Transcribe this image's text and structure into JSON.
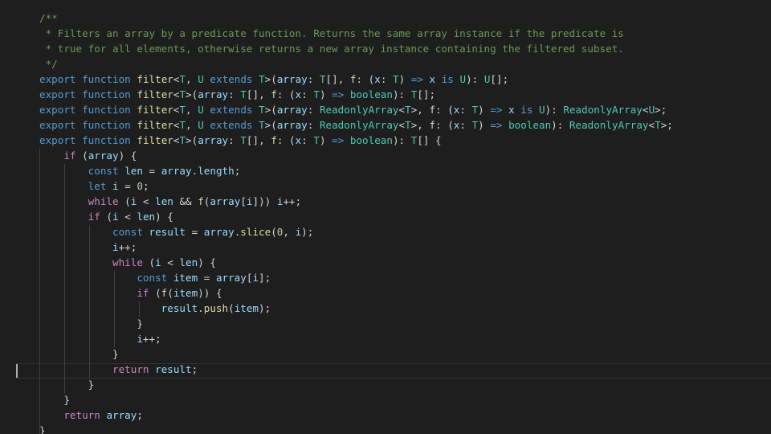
{
  "editor": {
    "theme_colors": {
      "background": "#1e1e1e",
      "keyword": "#569cd6",
      "control": "#c586c0",
      "function": "#dcdcaa",
      "type": "#4ec9b0",
      "variable": "#9cdcfe",
      "comment": "#6a9955",
      "number": "#b5cea8",
      "text": "#d4d4d4"
    },
    "lines": [
      [
        {
          "t": "/**",
          "c": "cm"
        }
      ],
      [
        {
          "t": " * Filters an array by a predicate function. Returns the same array instance if the predicate is",
          "c": "cm"
        }
      ],
      [
        {
          "t": " * true for all elements, otherwise returns a new array instance containing the filtered subset.",
          "c": "cm"
        }
      ],
      [
        {
          "t": " */",
          "c": "cm"
        }
      ],
      [
        {
          "t": "export",
          "c": "kw"
        },
        {
          "t": " "
        },
        {
          "t": "function",
          "c": "kw"
        },
        {
          "t": " "
        },
        {
          "t": "filter",
          "c": "fn"
        },
        {
          "t": "<"
        },
        {
          "t": "T",
          "c": "ty"
        },
        {
          "t": ", "
        },
        {
          "t": "U",
          "c": "ty"
        },
        {
          "t": " "
        },
        {
          "t": "extends",
          "c": "kw"
        },
        {
          "t": " "
        },
        {
          "t": "T",
          "c": "ty"
        },
        {
          "t": ">("
        },
        {
          "t": "array",
          "c": "var"
        },
        {
          "t": ": "
        },
        {
          "t": "T",
          "c": "ty"
        },
        {
          "t": "[], "
        },
        {
          "t": "f",
          "c": "fn"
        },
        {
          "t": ": ("
        },
        {
          "t": "x",
          "c": "var"
        },
        {
          "t": ": "
        },
        {
          "t": "T",
          "c": "ty"
        },
        {
          "t": ") "
        },
        {
          "t": "=>",
          "c": "kw"
        },
        {
          "t": " "
        },
        {
          "t": "x",
          "c": "var"
        },
        {
          "t": " "
        },
        {
          "t": "is",
          "c": "kw"
        },
        {
          "t": " "
        },
        {
          "t": "U",
          "c": "ty"
        },
        {
          "t": "): "
        },
        {
          "t": "U",
          "c": "ty"
        },
        {
          "t": "[];"
        }
      ],
      [
        {
          "t": "export",
          "c": "kw"
        },
        {
          "t": " "
        },
        {
          "t": "function",
          "c": "kw"
        },
        {
          "t": " "
        },
        {
          "t": "filter",
          "c": "fn"
        },
        {
          "t": "<"
        },
        {
          "t": "T",
          "c": "ty"
        },
        {
          "t": ">("
        },
        {
          "t": "array",
          "c": "var"
        },
        {
          "t": ": "
        },
        {
          "t": "T",
          "c": "ty"
        },
        {
          "t": "[], "
        },
        {
          "t": "f",
          "c": "fn"
        },
        {
          "t": ": ("
        },
        {
          "t": "x",
          "c": "var"
        },
        {
          "t": ": "
        },
        {
          "t": "T",
          "c": "ty"
        },
        {
          "t": ") "
        },
        {
          "t": "=>",
          "c": "kw"
        },
        {
          "t": " "
        },
        {
          "t": "boolean",
          "c": "ty"
        },
        {
          "t": "): "
        },
        {
          "t": "T",
          "c": "ty"
        },
        {
          "t": "[];"
        }
      ],
      [
        {
          "t": "export",
          "c": "kw"
        },
        {
          "t": " "
        },
        {
          "t": "function",
          "c": "kw"
        },
        {
          "t": " "
        },
        {
          "t": "filter",
          "c": "fn"
        },
        {
          "t": "<"
        },
        {
          "t": "T",
          "c": "ty"
        },
        {
          "t": ", "
        },
        {
          "t": "U",
          "c": "ty"
        },
        {
          "t": " "
        },
        {
          "t": "extends",
          "c": "kw"
        },
        {
          "t": " "
        },
        {
          "t": "T",
          "c": "ty"
        },
        {
          "t": ">("
        },
        {
          "t": "array",
          "c": "var"
        },
        {
          "t": ": "
        },
        {
          "t": "ReadonlyArray",
          "c": "ty"
        },
        {
          "t": "<"
        },
        {
          "t": "T",
          "c": "ty"
        },
        {
          "t": ">, "
        },
        {
          "t": "f",
          "c": "fn"
        },
        {
          "t": ": ("
        },
        {
          "t": "x",
          "c": "var"
        },
        {
          "t": ": "
        },
        {
          "t": "T",
          "c": "ty"
        },
        {
          "t": ") "
        },
        {
          "t": "=>",
          "c": "kw"
        },
        {
          "t": " "
        },
        {
          "t": "x",
          "c": "var"
        },
        {
          "t": " "
        },
        {
          "t": "is",
          "c": "kw"
        },
        {
          "t": " "
        },
        {
          "t": "U",
          "c": "ty"
        },
        {
          "t": "): "
        },
        {
          "t": "ReadonlyArray",
          "c": "ty"
        },
        {
          "t": "<"
        },
        {
          "t": "U",
          "c": "ty"
        },
        {
          "t": ">;"
        }
      ],
      [
        {
          "t": "export",
          "c": "kw"
        },
        {
          "t": " "
        },
        {
          "t": "function",
          "c": "kw"
        },
        {
          "t": " "
        },
        {
          "t": "filter",
          "c": "fn"
        },
        {
          "t": "<"
        },
        {
          "t": "T",
          "c": "ty"
        },
        {
          "t": ", "
        },
        {
          "t": "U",
          "c": "ty"
        },
        {
          "t": " "
        },
        {
          "t": "extends",
          "c": "kw"
        },
        {
          "t": " "
        },
        {
          "t": "T",
          "c": "ty"
        },
        {
          "t": ">("
        },
        {
          "t": "array",
          "c": "var"
        },
        {
          "t": ": "
        },
        {
          "t": "ReadonlyArray",
          "c": "ty"
        },
        {
          "t": "<"
        },
        {
          "t": "T",
          "c": "ty"
        },
        {
          "t": ">, "
        },
        {
          "t": "f",
          "c": "fn"
        },
        {
          "t": ": ("
        },
        {
          "t": "x",
          "c": "var"
        },
        {
          "t": ": "
        },
        {
          "t": "T",
          "c": "ty"
        },
        {
          "t": ") "
        },
        {
          "t": "=>",
          "c": "kw"
        },
        {
          "t": " "
        },
        {
          "t": "boolean",
          "c": "ty"
        },
        {
          "t": "): "
        },
        {
          "t": "ReadonlyArray",
          "c": "ty"
        },
        {
          "t": "<"
        },
        {
          "t": "T",
          "c": "ty"
        },
        {
          "t": ">;"
        }
      ],
      [
        {
          "t": "export",
          "c": "kw"
        },
        {
          "t": " "
        },
        {
          "t": "function",
          "c": "kw"
        },
        {
          "t": " "
        },
        {
          "t": "filter",
          "c": "fn"
        },
        {
          "t": "<"
        },
        {
          "t": "T",
          "c": "ty"
        },
        {
          "t": ">("
        },
        {
          "t": "array",
          "c": "var"
        },
        {
          "t": ": "
        },
        {
          "t": "T",
          "c": "ty"
        },
        {
          "t": "[], "
        },
        {
          "t": "f",
          "c": "fn"
        },
        {
          "t": ": ("
        },
        {
          "t": "x",
          "c": "var"
        },
        {
          "t": ": "
        },
        {
          "t": "T",
          "c": "ty"
        },
        {
          "t": ") "
        },
        {
          "t": "=>",
          "c": "kw"
        },
        {
          "t": " "
        },
        {
          "t": "boolean",
          "c": "ty"
        },
        {
          "t": "): "
        },
        {
          "t": "T",
          "c": "ty"
        },
        {
          "t": "[] {"
        }
      ],
      [
        {
          "t": "    "
        },
        {
          "t": "if",
          "c": "ctl"
        },
        {
          "t": " ("
        },
        {
          "t": "array",
          "c": "var"
        },
        {
          "t": ") {"
        }
      ],
      [
        {
          "t": "        "
        },
        {
          "t": "const",
          "c": "kw"
        },
        {
          "t": " "
        },
        {
          "t": "len",
          "c": "var"
        },
        {
          "t": " = "
        },
        {
          "t": "array",
          "c": "var"
        },
        {
          "t": "."
        },
        {
          "t": "length",
          "c": "var"
        },
        {
          "t": ";"
        }
      ],
      [
        {
          "t": "        "
        },
        {
          "t": "let",
          "c": "kw"
        },
        {
          "t": " "
        },
        {
          "t": "i",
          "c": "var"
        },
        {
          "t": " = "
        },
        {
          "t": "0",
          "c": "num"
        },
        {
          "t": ";"
        }
      ],
      [
        {
          "t": "        "
        },
        {
          "t": "while",
          "c": "ctl"
        },
        {
          "t": " ("
        },
        {
          "t": "i",
          "c": "var"
        },
        {
          "t": " < "
        },
        {
          "t": "len",
          "c": "var"
        },
        {
          "t": " && "
        },
        {
          "t": "f",
          "c": "fn"
        },
        {
          "t": "("
        },
        {
          "t": "array",
          "c": "var"
        },
        {
          "t": "["
        },
        {
          "t": "i",
          "c": "var"
        },
        {
          "t": "])) "
        },
        {
          "t": "i",
          "c": "var"
        },
        {
          "t": "++;"
        }
      ],
      [
        {
          "t": "        "
        },
        {
          "t": "if",
          "c": "ctl"
        },
        {
          "t": " ("
        },
        {
          "t": "i",
          "c": "var"
        },
        {
          "t": " < "
        },
        {
          "t": "len",
          "c": "var"
        },
        {
          "t": ") {"
        }
      ],
      [
        {
          "t": "            "
        },
        {
          "t": "const",
          "c": "kw"
        },
        {
          "t": " "
        },
        {
          "t": "result",
          "c": "var"
        },
        {
          "t": " = "
        },
        {
          "t": "array",
          "c": "var"
        },
        {
          "t": "."
        },
        {
          "t": "slice",
          "c": "fn"
        },
        {
          "t": "("
        },
        {
          "t": "0",
          "c": "num"
        },
        {
          "t": ", "
        },
        {
          "t": "i",
          "c": "var"
        },
        {
          "t": ");"
        }
      ],
      [
        {
          "t": "            "
        },
        {
          "t": "i",
          "c": "var"
        },
        {
          "t": "++;"
        }
      ],
      [
        {
          "t": "            "
        },
        {
          "t": "while",
          "c": "ctl"
        },
        {
          "t": " ("
        },
        {
          "t": "i",
          "c": "var"
        },
        {
          "t": " < "
        },
        {
          "t": "len",
          "c": "var"
        },
        {
          "t": ") {"
        }
      ],
      [
        {
          "t": "                "
        },
        {
          "t": "const",
          "c": "kw"
        },
        {
          "t": " "
        },
        {
          "t": "item",
          "c": "var"
        },
        {
          "t": " = "
        },
        {
          "t": "array",
          "c": "var"
        },
        {
          "t": "["
        },
        {
          "t": "i",
          "c": "var"
        },
        {
          "t": "];"
        }
      ],
      [
        {
          "t": "                "
        },
        {
          "t": "if",
          "c": "ctl"
        },
        {
          "t": " ("
        },
        {
          "t": "f",
          "c": "fn"
        },
        {
          "t": "("
        },
        {
          "t": "item",
          "c": "var"
        },
        {
          "t": ")) {"
        }
      ],
      [
        {
          "t": "                    "
        },
        {
          "t": "result",
          "c": "var"
        },
        {
          "t": "."
        },
        {
          "t": "push",
          "c": "fn"
        },
        {
          "t": "("
        },
        {
          "t": "item",
          "c": "var"
        },
        {
          "t": ");"
        }
      ],
      [
        {
          "t": "                }"
        }
      ],
      [
        {
          "t": "                "
        },
        {
          "t": "i",
          "c": "var"
        },
        {
          "t": "++;"
        }
      ],
      [
        {
          "t": "            }"
        }
      ],
      [
        {
          "t": "            "
        },
        {
          "t": "return",
          "c": "ctl"
        },
        {
          "t": " "
        },
        {
          "t": "result",
          "c": "var"
        },
        {
          "t": ";"
        }
      ],
      [
        {
          "t": "        }"
        }
      ],
      [
        {
          "t": "    }"
        }
      ],
      [
        {
          "t": "    "
        },
        {
          "t": "return",
          "c": "ctl"
        },
        {
          "t": " "
        },
        {
          "t": "array",
          "c": "var"
        },
        {
          "t": ";"
        }
      ],
      [
        {
          "t": "}"
        }
      ]
    ]
  }
}
